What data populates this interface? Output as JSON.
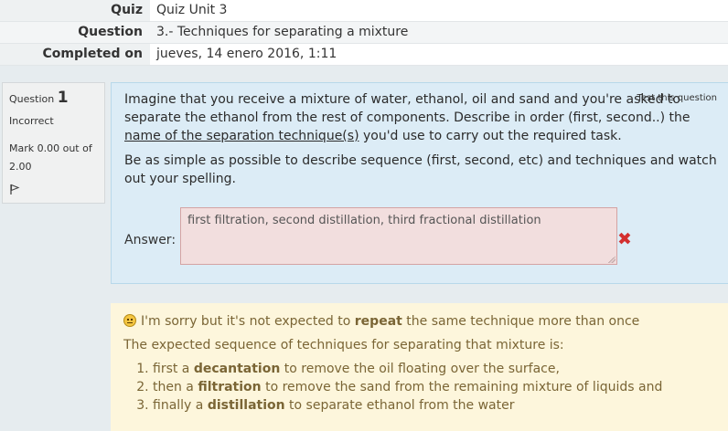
{
  "summary": {
    "rows": [
      {
        "label": "Quiz",
        "value": "Quiz Unit 3"
      },
      {
        "label": "Question",
        "value": "3.- Techniques for separating a mixture"
      },
      {
        "label": "Completed on",
        "value": "jueves, 14 enero 2016, 1:11"
      }
    ]
  },
  "info": {
    "question_word": "Question",
    "question_number": "1",
    "state": "Incorrect",
    "grade": "Mark 0.00 out of 2.00",
    "flag_icon": "flag-icon"
  },
  "question": {
    "test_link": "Test this question",
    "p1_before": "Imagine that you receive a mixture of water, ethanol, oil and sand and you're asked to separate the ethanol from the rest of components. Describe in order (first, second..) the ",
    "p1_underline": "name of the separation technique(s)",
    "p1_after": " you'd use to carry out the required task.",
    "p2": "Be as simple as possible to describe sequence (first, second, etc) and techniques and watch out your spelling.",
    "answer_label": "Answer:",
    "answer_value": "first filtration, second distillation, third fractional distillation",
    "incorrect_mark": "✖"
  },
  "feedback": {
    "line1_before": "I'm sorry but it's not expected to ",
    "line1_bold": "repeat",
    "line1_after": " the same technique more than once",
    "line2": "The expected sequence of techniques for separating that mixture is:",
    "steps": [
      {
        "before": "first a ",
        "bold": "decantation",
        "after": " to remove the oil floating over the surface,"
      },
      {
        "before": "then a ",
        "bold": "filtration",
        "after": " to remove the sand from the remaining mixture of liquids and"
      },
      {
        "before": "finally a ",
        "bold": "distillation",
        "after": " to separate ethanol from the water"
      }
    ]
  }
}
